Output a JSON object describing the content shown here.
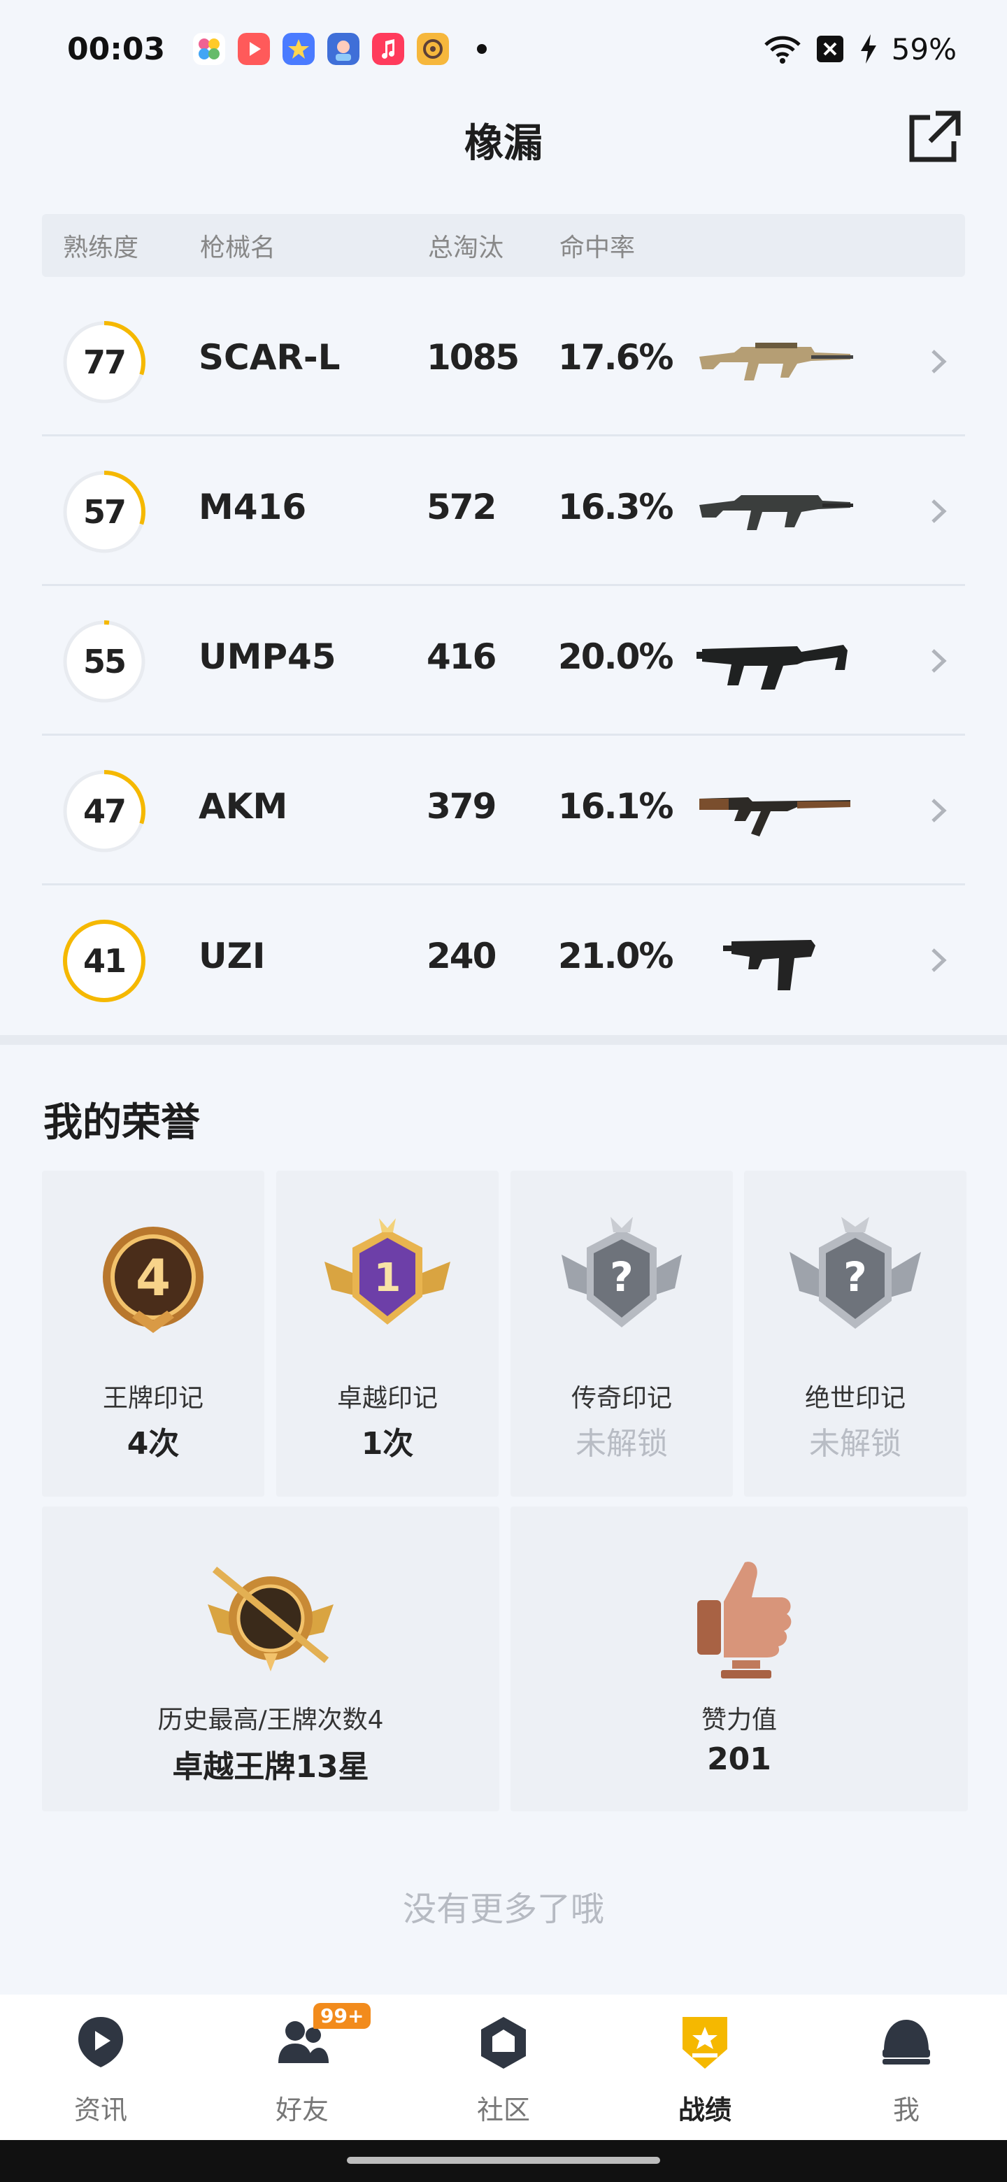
{
  "status_bar": {
    "time": "00:03",
    "battery": "59%",
    "icons": [
      "photos-icon",
      "video-icon",
      "star-app-icon",
      "game-app-icon",
      "music-icon",
      "radio-app-icon"
    ]
  },
  "header": {
    "title": "橡漏",
    "share_icon": "external-link-icon"
  },
  "table": {
    "columns": [
      "熟练度",
      "枪械名",
      "总淘汰",
      "命中率"
    ],
    "rows": [
      {
        "proficiency": "77",
        "level": 0.3,
        "name": "SCAR-L",
        "kills": "1085",
        "hit_rate": "17.6%",
        "gun": "scar-l-rifle"
      },
      {
        "proficiency": "57",
        "level": 0.3,
        "name": "M416",
        "kills": "572",
        "hit_rate": "16.3%",
        "gun": "m416-rifle"
      },
      {
        "proficiency": "55",
        "level": 0.02,
        "name": "UMP45",
        "kills": "416",
        "hit_rate": "20.0%",
        "gun": "ump45-smg"
      },
      {
        "proficiency": "47",
        "level": 0.3,
        "name": "AKM",
        "kills": "379",
        "hit_rate": "16.1%",
        "gun": "akm-rifle"
      },
      {
        "proficiency": "41",
        "level": 1.0,
        "name": "UZI",
        "kills": "240",
        "hit_rate": "21.0%",
        "gun": "uzi-smg"
      }
    ]
  },
  "honors": {
    "title": "我的荣誉",
    "medals": [
      {
        "name": "王牌印记",
        "value": "4次",
        "locked": false,
        "icon": "ace-medal-icon"
      },
      {
        "name": "卓越印记",
        "value": "1次",
        "locked": false,
        "icon": "elite-medal-icon"
      },
      {
        "name": "传奇印记",
        "value": "未解锁",
        "locked": true,
        "icon": "legend-medal-locked-icon"
      },
      {
        "name": "绝世印记",
        "value": "未解锁",
        "locked": true,
        "icon": "peerless-medal-locked-icon"
      }
    ],
    "highest": {
      "name": "历史最高/王牌次数4",
      "value": "卓越王牌13星",
      "icon": "rank-badge-icon"
    },
    "likes": {
      "name": "赞力值",
      "value": "201",
      "icon": "thumbs-up-trophy-icon"
    }
  },
  "footer_text": "没有更多了哦",
  "bottom_nav": {
    "items": [
      {
        "label": "资讯",
        "icon": "news-icon",
        "active": false
      },
      {
        "label": "好友",
        "icon": "friends-icon",
        "active": false,
        "badge": "99+"
      },
      {
        "label": "社区",
        "icon": "community-icon",
        "active": false
      },
      {
        "label": "战绩",
        "icon": "record-icon",
        "active": true
      },
      {
        "label": "我",
        "icon": "profile-helmet-icon",
        "active": false
      }
    ]
  },
  "colors": {
    "accent": "#f5b800",
    "background": "#f3f6fb",
    "badge": "#f28b1c"
  }
}
